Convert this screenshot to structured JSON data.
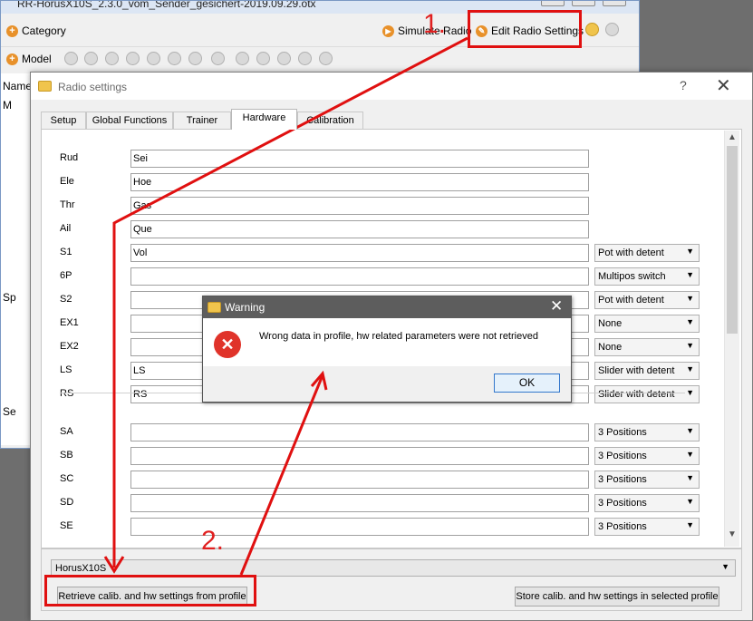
{
  "main_window": {
    "title": "RR-HorusX10S_2.3.0_vom_Sender_gesichert-2019.09.29.otx",
    "toolbar": {
      "category_label": "Category",
      "simulate_label": "Simulate Radio",
      "edit_radio_label": "Edit Radio Settings",
      "model_label": "Model"
    },
    "tree": [
      "Name",
      "M",
      "Sp",
      "Se"
    ]
  },
  "radio_dialog": {
    "title": "Radio settings",
    "help": "?",
    "close": "✕",
    "tabs": [
      "Setup",
      "Global Functions",
      "Trainer",
      "Hardware",
      "Calibration"
    ],
    "active_tab": "Hardware",
    "hardware_rows": [
      {
        "label": "Rud",
        "value": "Sei",
        "select": ""
      },
      {
        "label": "Ele",
        "value": "Hoe",
        "select": ""
      },
      {
        "label": "Thr",
        "value": "Gas",
        "select": ""
      },
      {
        "label": "Ail",
        "value": "Que",
        "select": ""
      },
      {
        "label": "S1",
        "value": "Vol",
        "select": "Pot with detent"
      },
      {
        "label": "6P",
        "value": "",
        "select": "Multipos switch"
      },
      {
        "label": "S2",
        "value": "",
        "select": "Pot with detent"
      },
      {
        "label": "EX1",
        "value": "",
        "select": "None"
      },
      {
        "label": "EX2",
        "value": "",
        "select": "None"
      },
      {
        "label": "LS",
        "value": "LS",
        "select": "Slider with detent"
      },
      {
        "label": "RS",
        "value": "RS",
        "select": "Slider with detent"
      }
    ],
    "switch_rows": [
      {
        "label": "SA",
        "value": "",
        "select": "3 Positions"
      },
      {
        "label": "SB",
        "value": "",
        "select": "3 Positions"
      },
      {
        "label": "SC",
        "value": "",
        "select": "3 Positions"
      },
      {
        "label": "SD",
        "value": "",
        "select": "3 Positions"
      },
      {
        "label": "SE",
        "value": "",
        "select": "3 Positions"
      }
    ],
    "profile": "HorusX10S",
    "retrieve_label": "Retrieve calib. and hw settings from profile",
    "store_label": "Store calib. and hw settings in selected profile"
  },
  "warning_dialog": {
    "title": "Warning",
    "message": "Wrong data in profile, hw related parameters were not retrieved",
    "ok_label": "OK"
  },
  "annotations": {
    "step1": "1.",
    "step2": "2.",
    "color": "#e01010"
  }
}
